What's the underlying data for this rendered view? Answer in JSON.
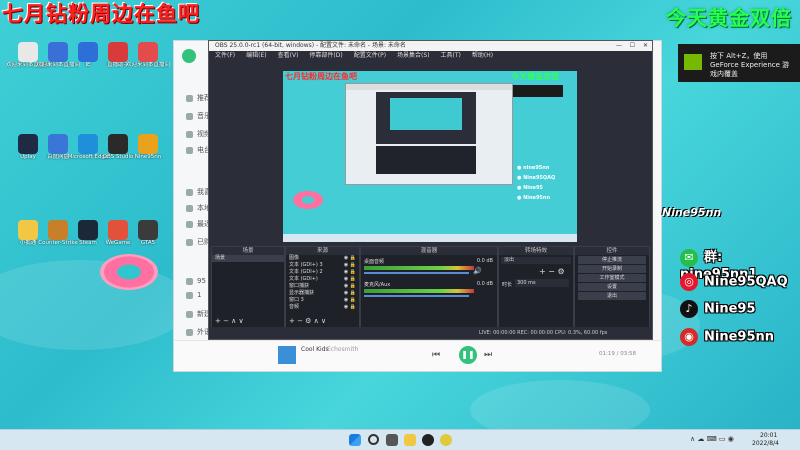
{
  "overlay": {
    "red_title": "七月钻粉周边在鱼吧",
    "green_title": "今天黄金双倍"
  },
  "desktop_icons": [
    {
      "label": "欢迎来到本直播间",
      "color": "#e8e8e8"
    },
    {
      "label": "欢迎来到本直播间",
      "color": "#3b6fd8"
    },
    {
      "label": "IE",
      "color": "#2d6fd6"
    },
    {
      "label": "直播助手",
      "color": "#d83b3b"
    },
    {
      "label": "欢迎来到本直播间",
      "color": "#e24c4c"
    },
    {
      "label": "Uplay",
      "color": "#1f2a44"
    },
    {
      "label": "百度网盘",
      "color": "#3a76d6"
    },
    {
      "label": "Microsoft Edge",
      "color": "#1e8fd8"
    },
    {
      "label": "OBS Studio",
      "color": "#2a2a2a"
    },
    {
      "label": "Nine95nn",
      "color": "#e8a21c"
    },
    {
      "label": "小鹅通",
      "color": "#f2c744"
    },
    {
      "label": "Counter-Strike",
      "color": "#c87f2a"
    },
    {
      "label": "Steam",
      "color": "#1b2838"
    },
    {
      "label": "WeGame",
      "color": "#e2513a"
    },
    {
      "label": "GTA5",
      "color": "#3b3b3b"
    }
  ],
  "music_app": {
    "sidebar": [
      "推荐",
      "音乐馆",
      "视频",
      "电台",
      "我喜欢",
      "本地",
      "最近播放",
      "已购",
      "95",
      "1",
      "新建歌单",
      "外语",
      "自建歌单"
    ],
    "now_playing": {
      "title": "Cool Kids",
      "artist": "Echosmith",
      "time": "01:19 / 03:58"
    }
  },
  "obs": {
    "title": "OBS 25.0.0-rc1 (64-bit, windows) - 配置文件: 未命名 - 场景: 未命名",
    "menu": [
      "文件(F)",
      "编辑(E)",
      "查看(V)",
      "停靠部件(D)",
      "配置文件(P)",
      "场景集合(S)",
      "工具(T)",
      "帮助(H)"
    ],
    "docks": {
      "scenes": {
        "header": "场景",
        "items": [
          "场景"
        ]
      },
      "sources": {
        "header": "来源",
        "items": [
          "图像",
          "文本 (GDI+) 3",
          "文本 (GDI+) 2",
          "文本 (GDI+)",
          "窗口捕获",
          "显示器捕获",
          "窗口 3",
          "音频"
        ]
      },
      "mixer": {
        "header": "混音器",
        "channels": [
          {
            "name": "桌面音频",
            "db": "0.0 dB"
          },
          {
            "name": "麦克风/Aux",
            "db": "0.0 dB"
          }
        ]
      },
      "transitions": {
        "header": "转场特效",
        "type": "淡出",
        "duration_label": "时长",
        "duration": "300 ms"
      },
      "controls": {
        "header": "控件",
        "buttons": [
          "停止推流",
          "开始录制",
          "工作室模式",
          "设置",
          "退出"
        ]
      }
    },
    "status": "LIVE: 00:00:00    REC: 00:00:00    CPU: 0.3%, 60.00 fps",
    "preview_overlay_green": "今天黄金双倍",
    "preview_overlay_red": "七月钻粉周边在鱼吧"
  },
  "nvidia": {
    "text": "按下 Alt+Z，使用 GeForce Experience 游戏内覆盖"
  },
  "social": [
    {
      "icon": "wechat-icon",
      "prefix": "群: ",
      "text": "nine95nn1",
      "color": "#22c04a"
    },
    {
      "icon": "weibo-icon",
      "prefix": "",
      "text": "Nine95QAQ",
      "color": "#e6162d"
    },
    {
      "icon": "tiktok-icon",
      "prefix": "",
      "text": "Nine95",
      "color": "#111111"
    },
    {
      "icon": "netease-icon",
      "prefix": "",
      "text": "Nine95nn",
      "color": "#d42b2b"
    }
  ],
  "side_label": "Nine95nn",
  "taskbar": {
    "time": "20:01",
    "date": "2022/8/4"
  }
}
